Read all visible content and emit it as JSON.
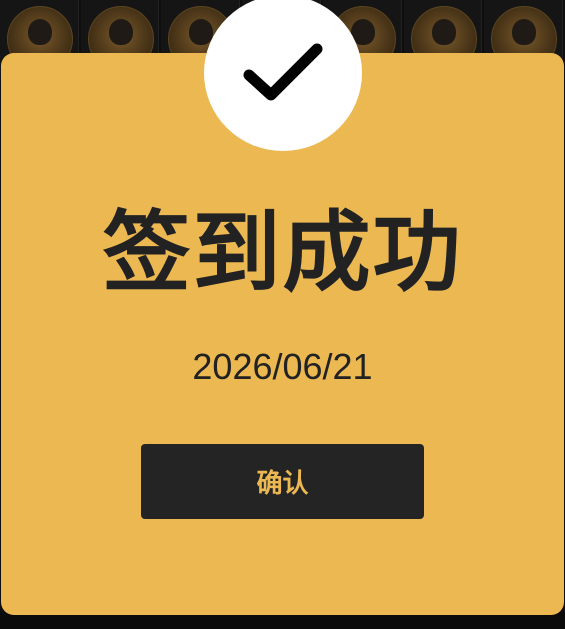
{
  "dialog": {
    "title": "签到成功",
    "date": "2026/06/21",
    "confirm_label": "确认",
    "icon": "checkmark-icon"
  },
  "colors": {
    "card_background": "#ecb852",
    "text": "#222222",
    "button_background": "#242424",
    "button_text": "#ecb852",
    "check_circle": "#ffffff",
    "backdrop": "#0e0e0e"
  }
}
